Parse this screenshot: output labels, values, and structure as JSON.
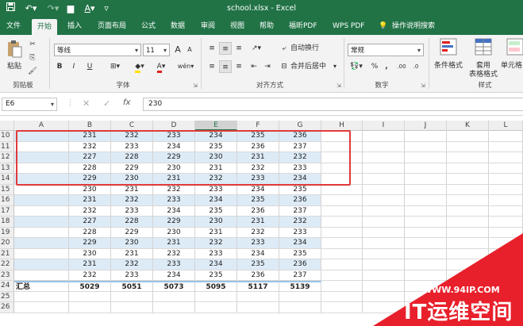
{
  "window": {
    "title": "school.xlsx  -  Excel"
  },
  "qat": {
    "autosave_icon": "save-icon",
    "undo_icon": "undo-icon",
    "redo_icon": "redo-icon"
  },
  "tabs": [
    "文件",
    "开始",
    "插入",
    "页面布局",
    "公式",
    "数据",
    "审阅",
    "视图",
    "帮助",
    "福昕PDF",
    "WPS PDF",
    "操作说明搜索"
  ],
  "ribbon": {
    "clipboard": {
      "paste": "粘贴",
      "group": "剪贴板"
    },
    "font": {
      "name": "等线",
      "size": "11",
      "bold": "B",
      "italic": "I",
      "underline": "U",
      "grow": "A",
      "shrink": "A",
      "group": "字体"
    },
    "alignment": {
      "wrap": "自动换行",
      "merge": "合并后居中",
      "group": "对齐方式"
    },
    "number": {
      "format": "常规",
      "percent": "%",
      "comma": ",",
      "group": "数字"
    },
    "styles": {
      "conditional": "条件格式",
      "table": "套用",
      "table2": "表格格式",
      "cell": "单元格",
      "group": "样式"
    }
  },
  "formula_bar": {
    "name_box": "E6",
    "value": "230"
  },
  "columns": [
    "A",
    "B",
    "C",
    "D",
    "E",
    "F",
    "G",
    "H",
    "I",
    "J",
    "K",
    "L"
  ],
  "selected_column": "E",
  "rows": [
    {
      "n": "10",
      "a": "",
      "v": [
        "231",
        "232",
        "233",
        "234",
        "235",
        "236"
      ]
    },
    {
      "n": "11",
      "a": "",
      "v": [
        "232",
        "233",
        "234",
        "235",
        "236",
        "237"
      ]
    },
    {
      "n": "12",
      "a": "",
      "v": [
        "227",
        "228",
        "229",
        "230",
        "231",
        "232"
      ]
    },
    {
      "n": "13",
      "a": "",
      "v": [
        "228",
        "229",
        "230",
        "231",
        "232",
        "233"
      ]
    },
    {
      "n": "14",
      "a": "",
      "v": [
        "229",
        "230",
        "231",
        "232",
        "233",
        "234"
      ]
    },
    {
      "n": "15",
      "a": "",
      "v": [
        "230",
        "231",
        "232",
        "233",
        "234",
        "235"
      ]
    },
    {
      "n": "16",
      "a": "",
      "v": [
        "231",
        "232",
        "233",
        "234",
        "235",
        "236"
      ]
    },
    {
      "n": "17",
      "a": "",
      "v": [
        "232",
        "233",
        "234",
        "235",
        "236",
        "237"
      ]
    },
    {
      "n": "18",
      "a": "",
      "v": [
        "227",
        "228",
        "229",
        "230",
        "231",
        "232"
      ]
    },
    {
      "n": "19",
      "a": "",
      "v": [
        "228",
        "229",
        "230",
        "231",
        "232",
        "233"
      ]
    },
    {
      "n": "20",
      "a": "",
      "v": [
        "229",
        "230",
        "231",
        "232",
        "233",
        "234"
      ]
    },
    {
      "n": "21",
      "a": "",
      "v": [
        "230",
        "231",
        "232",
        "233",
        "234",
        "235"
      ]
    },
    {
      "n": "22",
      "a": "",
      "v": [
        "231",
        "232",
        "233",
        "234",
        "235",
        "236"
      ]
    },
    {
      "n": "23",
      "a": "",
      "v": [
        "232",
        "233",
        "234",
        "235",
        "236",
        "237"
      ]
    },
    {
      "n": "24",
      "a": "汇总",
      "v": [
        "5029",
        "5051",
        "5073",
        "5095",
        "5117",
        "5139"
      ]
    },
    {
      "n": "25",
      "a": "",
      "v": [
        "",
        "",
        "",
        "",
        "",
        ""
      ]
    },
    {
      "n": "26",
      "a": "",
      "v": [
        "",
        "",
        "",
        "",
        "",
        ""
      ]
    }
  ],
  "watermark": {
    "url": "WWW.94IP.COM",
    "name": "IT运维空间"
  },
  "colors": {
    "brand": "#217346",
    "band": "#ddebf7",
    "highlight": "#e03a3a"
  }
}
